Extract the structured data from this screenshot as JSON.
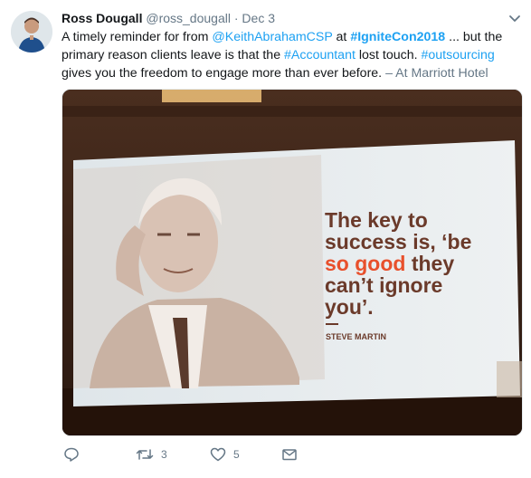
{
  "tweet": {
    "author_name": "Ross Dougall",
    "author_handle": "@ross_dougall",
    "separator": "·",
    "date": "Dec 3",
    "text": {
      "t1": "A timely reminder for from ",
      "mention": "@KeithAbrahamCSP",
      "t2": " at ",
      "hashtag_event": "#IgniteCon2018",
      "t3": " ... but the primary reason clients leave is that the ",
      "hashtag_accountant": "#Accountant",
      "t4": " lost touch. ",
      "hashtag_outsourcing": "#outsourcing",
      "t5": " gives you the freedom to engage more than ever before.",
      "location": " – At Marriott Hotel"
    }
  },
  "media": {
    "slide": {
      "line1": "The key to",
      "line2": "success is, ‘be",
      "line3_highlight": "so good",
      "line3_rest": " they",
      "line4": "can’t ignore",
      "line5": "you’.",
      "attribution": "STEVE MARTIN"
    },
    "colors": {
      "slide_text": "#6b3a2a",
      "highlight": "#e8502c"
    }
  },
  "actions": {
    "reply_icon": "reply-icon",
    "retweet_icon": "retweet-icon",
    "retweet_count": "3",
    "like_icon": "heart-icon",
    "like_count": "5",
    "dm_icon": "envelope-icon"
  },
  "colors": {
    "link": "#1da1f2",
    "muted": "#657786"
  }
}
